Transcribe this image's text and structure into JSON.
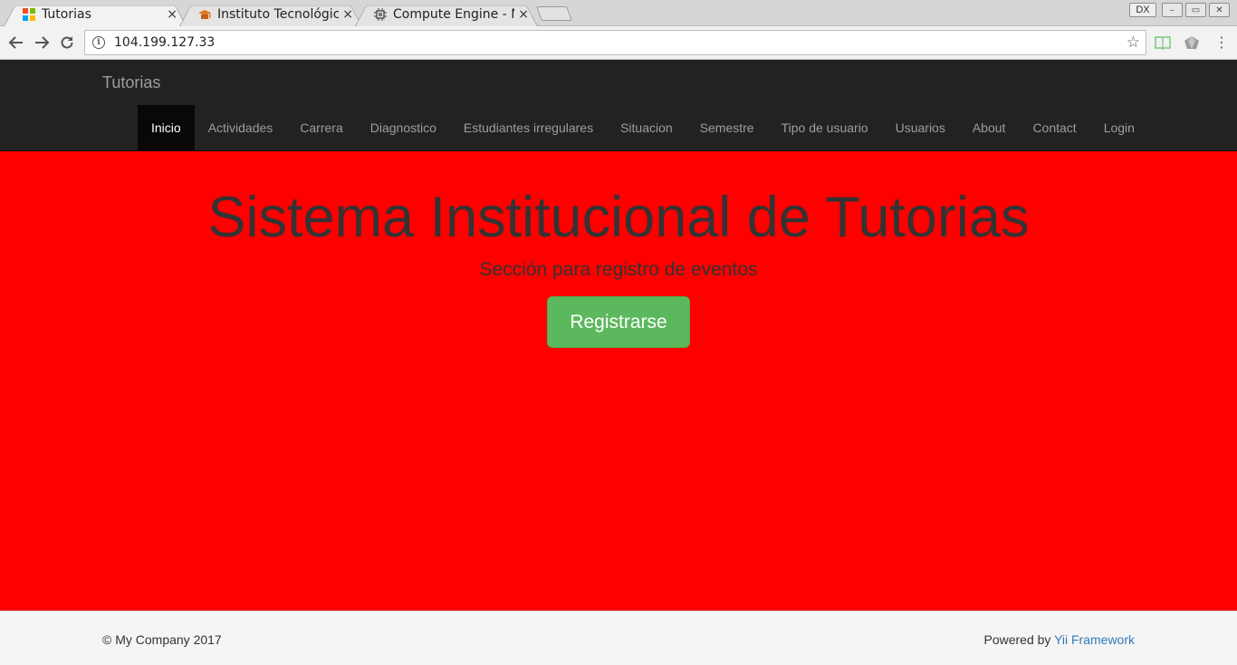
{
  "browser": {
    "tabs": [
      {
        "title": "Tutorias",
        "close": "×",
        "active": true
      },
      {
        "title": "Instituto Tecnológico",
        "close": "×",
        "active": false
      },
      {
        "title": "Compute Engine - Mi",
        "close": "×",
        "active": false
      }
    ],
    "address": "104.199.127.33",
    "window_buttons": [
      "DX",
      "–",
      "▭",
      "✕"
    ]
  },
  "navbar": {
    "brand": "Tutorias",
    "items": [
      {
        "label": "Inicio",
        "active": true
      },
      {
        "label": "Actividades"
      },
      {
        "label": "Carrera"
      },
      {
        "label": "Diagnostico"
      },
      {
        "label": "Estudiantes irregulares"
      },
      {
        "label": "Situacion"
      },
      {
        "label": "Semestre"
      },
      {
        "label": "Tipo de usuario"
      },
      {
        "label": "Usuarios"
      },
      {
        "label": "About"
      },
      {
        "label": "Contact"
      },
      {
        "label": "Login"
      }
    ]
  },
  "hero": {
    "title": "Sistema Institucional de Tutorias",
    "subtitle": "Sección para registro de eventos",
    "button": "Registrarse",
    "background": "#ff0000"
  },
  "footer": {
    "copyright": "© My Company 2017",
    "powered_prefix": "Powered by ",
    "powered_link": "Yii Framework"
  },
  "colors": {
    "navbar_bg": "#222222",
    "button_success": "#5cb85c",
    "link": "#337ab7"
  }
}
